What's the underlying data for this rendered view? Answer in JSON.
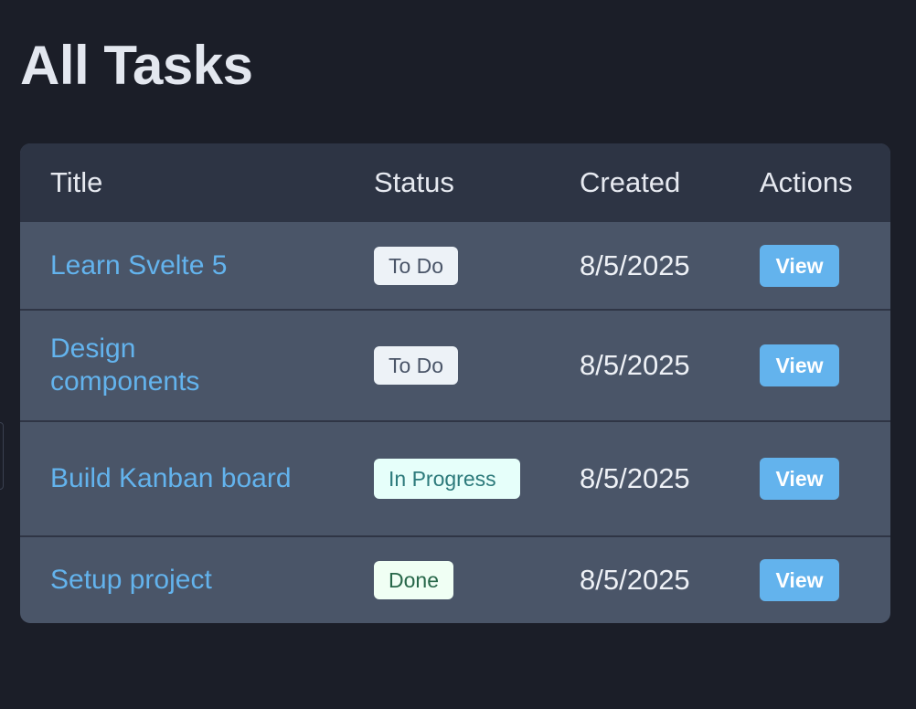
{
  "page": {
    "title": "All Tasks"
  },
  "table": {
    "headers": {
      "title": "Title",
      "status": "Status",
      "created": "Created",
      "actions": "Actions"
    },
    "rows": [
      {
        "title": "Learn Svelte 5",
        "status": "To Do",
        "status_kind": "todo",
        "created": "8/5/2025",
        "action": "View"
      },
      {
        "title": "Design components",
        "status": "To Do",
        "status_kind": "todo",
        "created": "8/5/2025",
        "action": "View"
      },
      {
        "title": "Build Kanban board",
        "status": "In Progress",
        "status_kind": "in-progress",
        "created": "8/5/2025",
        "action": "View"
      },
      {
        "title": "Setup project",
        "status": "Done",
        "status_kind": "done",
        "created": "8/5/2025",
        "action": "View"
      }
    ]
  },
  "colors": {
    "background": "#1b1e28",
    "header_bg": "#2d3444",
    "row_bg": "#4a5568",
    "link": "#63b3ed",
    "button": "#63b3ed"
  }
}
